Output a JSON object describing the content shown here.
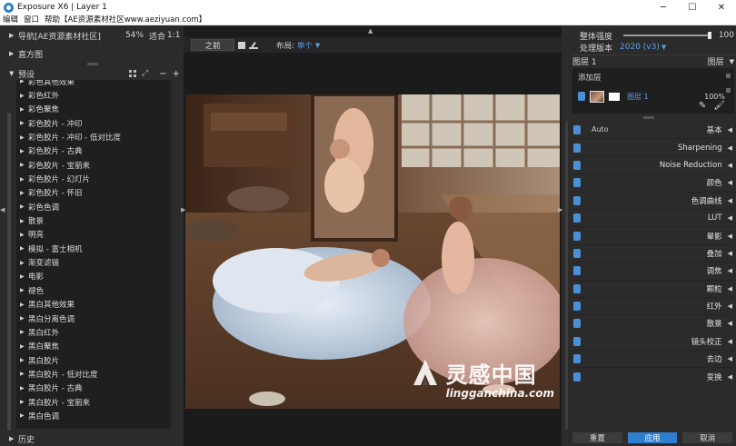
{
  "window": {
    "title": "Exposure X6 | Layer 1",
    "controls": [
      "─",
      "☐",
      "✕"
    ]
  },
  "menu": [
    "编辑",
    "窗口",
    "帮助【AE资源素材社区www.aeziyuan.com】"
  ],
  "left_panel": {
    "navigator": {
      "label": "导航[AE资源素材社区]",
      "zoom": "54%",
      "fit": "适合",
      "ratio": "1:1"
    },
    "histogram": {
      "label": "直方图"
    },
    "presets": {
      "label": "预设",
      "tools": [
        "▦",
        "⤢",
        "−",
        "+"
      ],
      "items": [
        "彩色其他效果",
        "彩色红外",
        "彩色聚焦",
        "彩色胶片 - 冲印",
        "彩色胶片 - 冲印 - 低对比度",
        "彩色胶片 - 古典",
        "彩色胶片 - 宝丽来",
        "彩色胶片 - 幻灯片",
        "彩色胶片 - 怀旧",
        "彩色色调",
        "散景",
        "明亮",
        "模拟 - 富士相机",
        "渐变滤镜",
        "电影",
        "褪色",
        "黑白其他效果",
        "黑白分离色调",
        "黑白红外",
        "黑白聚焦",
        "黑白胶片",
        "黑白胶片 - 低对比度",
        "黑白胶片 - 古典",
        "黑白胶片 - 宝丽来",
        "黑白色调"
      ]
    },
    "history": {
      "label": "历史"
    }
  },
  "center": {
    "before_label": "之前",
    "layout_label": "布局:",
    "layout_value": "单个",
    "watermark": {
      "title": "灵感中国",
      "url": "lingganchina.com"
    }
  },
  "right_panel": {
    "overall_strength": {
      "label": "整体强度",
      "value": "100",
      "level": 1.0
    },
    "process_version": {
      "label": "处理版本",
      "value": "2020 (v3)"
    },
    "layers_header": {
      "label": "图层 1",
      "tab": "图层"
    },
    "add_layer": "添加层",
    "layer": {
      "name": "图层 1",
      "opacity": "100%"
    },
    "adjustments": [
      {
        "name": "基本",
        "auto": "Auto"
      },
      {
        "name": "Sharpening"
      },
      {
        "name": "Noise Reduction"
      },
      {
        "name": "颜色"
      },
      {
        "name": "色调曲线"
      },
      {
        "name": "LUT"
      },
      {
        "name": "晕影"
      },
      {
        "name": "叠加"
      },
      {
        "name": "调焦"
      },
      {
        "name": "颗粒"
      },
      {
        "name": "红外"
      },
      {
        "name": "散景"
      },
      {
        "name": "镜头校正"
      },
      {
        "name": "去边"
      },
      {
        "name": "变换"
      }
    ],
    "buttons": {
      "reset": "重置",
      "apply": "应用",
      "cancel": "取消"
    }
  },
  "colors": {
    "accent": "#2f7fd0",
    "link": "#5aa0e8",
    "panel": "#2b2b2b",
    "list_bg": "#1f1f1f"
  }
}
